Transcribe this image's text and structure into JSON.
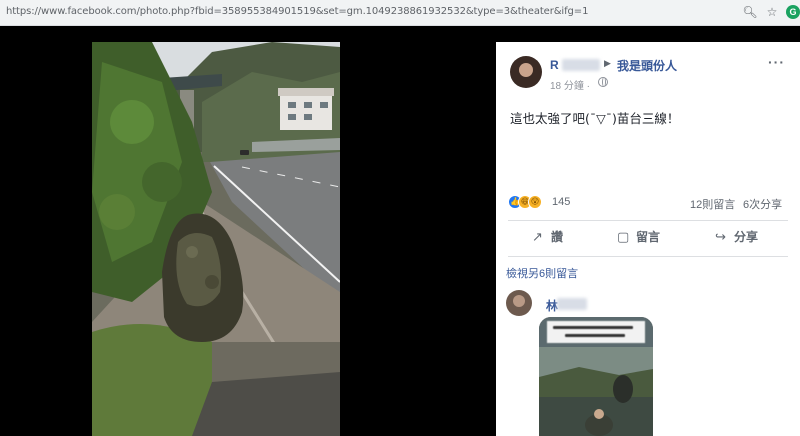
{
  "browser": {
    "url": "https://www.facebook.com/photo.php?fbid=358955384901519&set=gm.1049238861932532&type=3&theater&ifg=1",
    "zoom_icon": "zoom-icon",
    "star_icon": "star-icon"
  },
  "post": {
    "poster_initial": "R",
    "group_arrow": "▶",
    "group_name": "我是頭份人",
    "time": "18 分鐘 ·",
    "text": "這也太強了吧(¯▽¯)苗台三線！",
    "more": "···"
  },
  "stats": {
    "reactions_count": "145",
    "reaction_like_icon": "👍",
    "reaction_haha_icon": "😆",
    "reaction_wow_icon": "😮",
    "comments": "12則留言",
    "shares": "6次分享"
  },
  "actions": {
    "like": "讚",
    "comment": "留言",
    "share": "分享",
    "like_icon": "👍",
    "comment_icon": "▢",
    "share_icon": "↪"
  },
  "comments": {
    "view_more": "檢視另6則留言",
    "first_commenter_initial": "林"
  },
  "colors": {
    "link": "#385898",
    "secondary": "#606770",
    "like_blue": "#2078f4"
  }
}
